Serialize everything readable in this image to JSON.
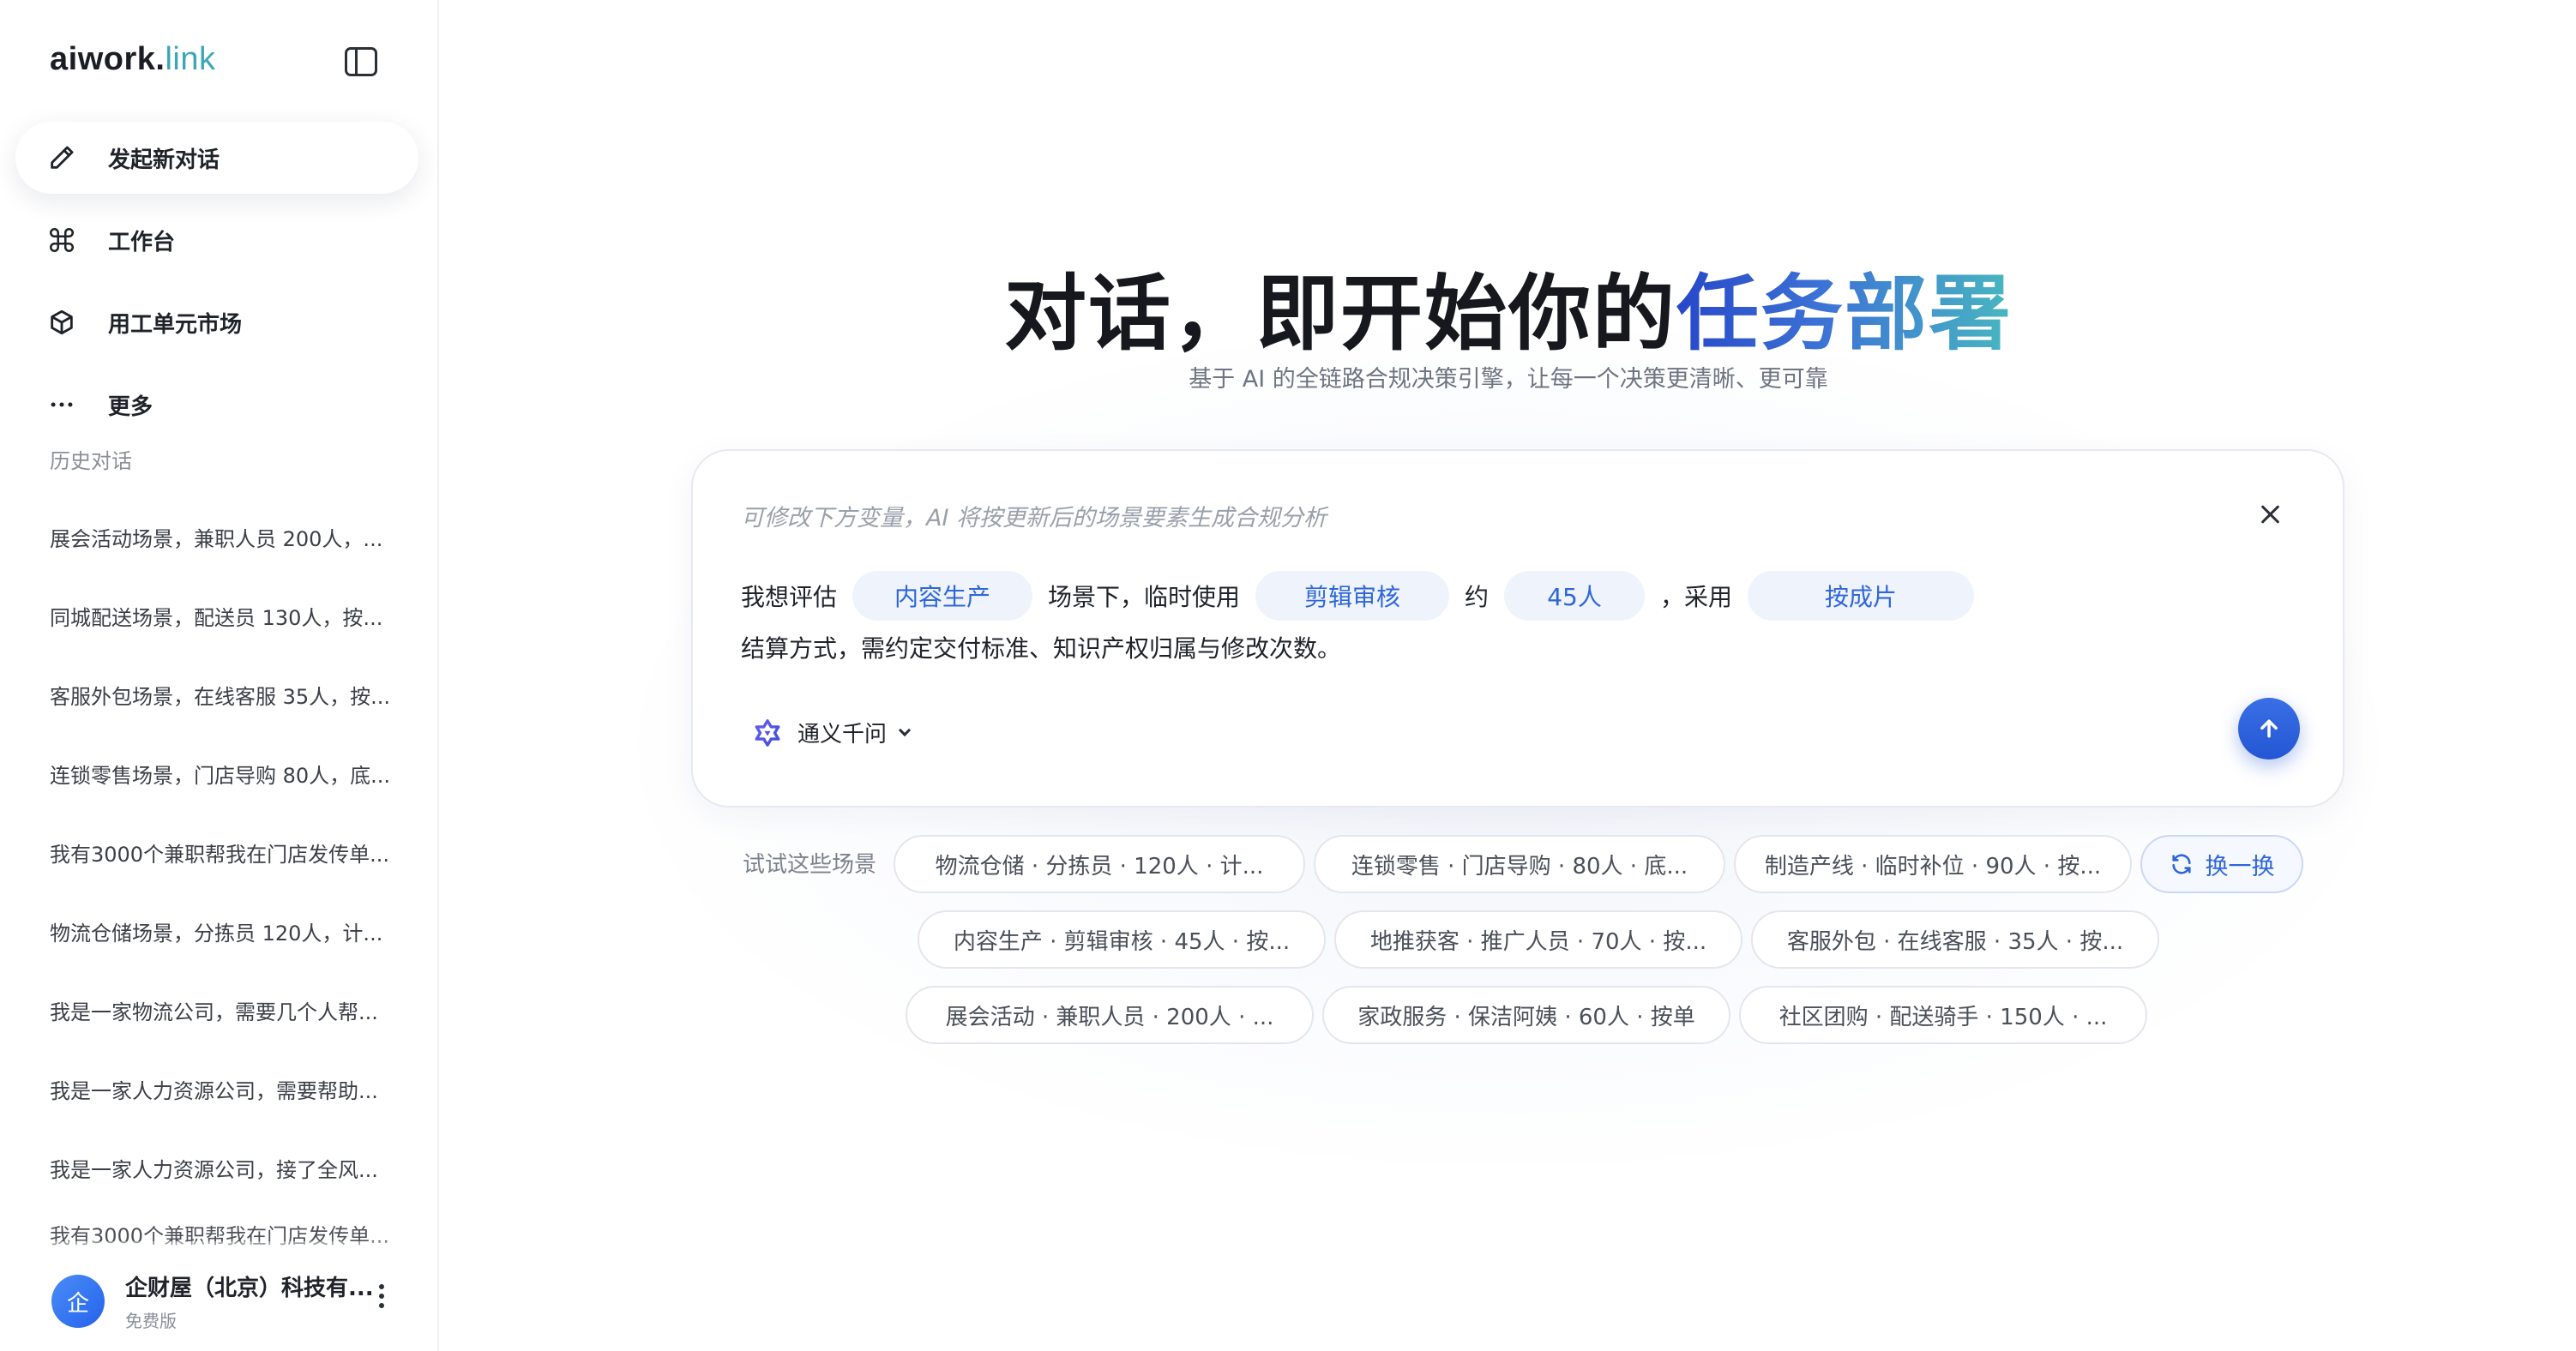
{
  "brand": {
    "name": "aiwork",
    "dot": ".",
    "suffix": "link"
  },
  "sidebar": {
    "nav": [
      {
        "label": "发起新对话",
        "icon": "pencil-icon"
      },
      {
        "label": "工作台",
        "icon": "command-icon"
      },
      {
        "label": "用工单元市场",
        "icon": "cube-icon"
      },
      {
        "label": "更多",
        "icon": "ellipsis-icon"
      }
    ],
    "history_title": "历史对话",
    "history": [
      "展会活动场景，兼职人员 200人，...",
      "同城配送场景，配送员 130人，按...",
      "客服外包场景，在线客服 35人，按...",
      "连锁零售场景，门店导购 80人，底...",
      "我有3000个兼职帮我在门店发传单...",
      "物流仓储场景，分拣员 120人，计...",
      "我是一家物流公司，需要几个人帮...",
      "我是一家人力资源公司，需要帮助...",
      "我是一家人力资源公司，接了全风...",
      "我有3000个兼职帮我在门店发传单..."
    ],
    "account": {
      "avatar_char": "企",
      "name": "企财屋（北京）科技有...",
      "plan": "免费版"
    }
  },
  "hero": {
    "title_plain": "对话，即开始你的",
    "title_highlight": "任务部署",
    "subtitle": "基于 AI 的全链路合规决策引擎，让每一个决策更清晰、更可靠"
  },
  "composer": {
    "hint": "可修改下方变量，AI 将按更新后的场景要素生成合规分析",
    "t1": "我想评估",
    "v_scene": "内容生产",
    "t2": "场景下，临时使用",
    "v_role": "剪辑审核",
    "t3": "约",
    "v_count": "45人",
    "t4": "，采用",
    "v_settle": "按成片",
    "t5": "结算方式，需约定交付标准、知识产权归属与修改次数。",
    "model": "通义千问"
  },
  "suggestions": {
    "label": "试试这些场景",
    "refresh": "换一换",
    "row1": [
      "物流仓储 · 分拣员 · 120人 · 计...",
      "连锁零售 · 门店导购 · 80人 · 底...",
      "制造产线 · 临时补位 · 90人 · 按..."
    ],
    "row2": [
      "内容生产 · 剪辑审核 · 45人 · 按...",
      "地推获客 · 推广人员 · 70人 · 按...",
      "客服外包 · 在线客服 · 35人 · 按..."
    ],
    "row3": [
      "展会活动 · 兼职人员 · 200人 · ...",
      "家政服务 · 保洁阿姨 · 60人 · 按单",
      "社区团购 · 配送骑手 · 150人 · ..."
    ]
  },
  "colors": {
    "accent": "#2f66d9",
    "chip_bg": "#eef3fc",
    "title_gradient_start": "#2747c9",
    "title_gradient_end": "#48b7c0"
  }
}
